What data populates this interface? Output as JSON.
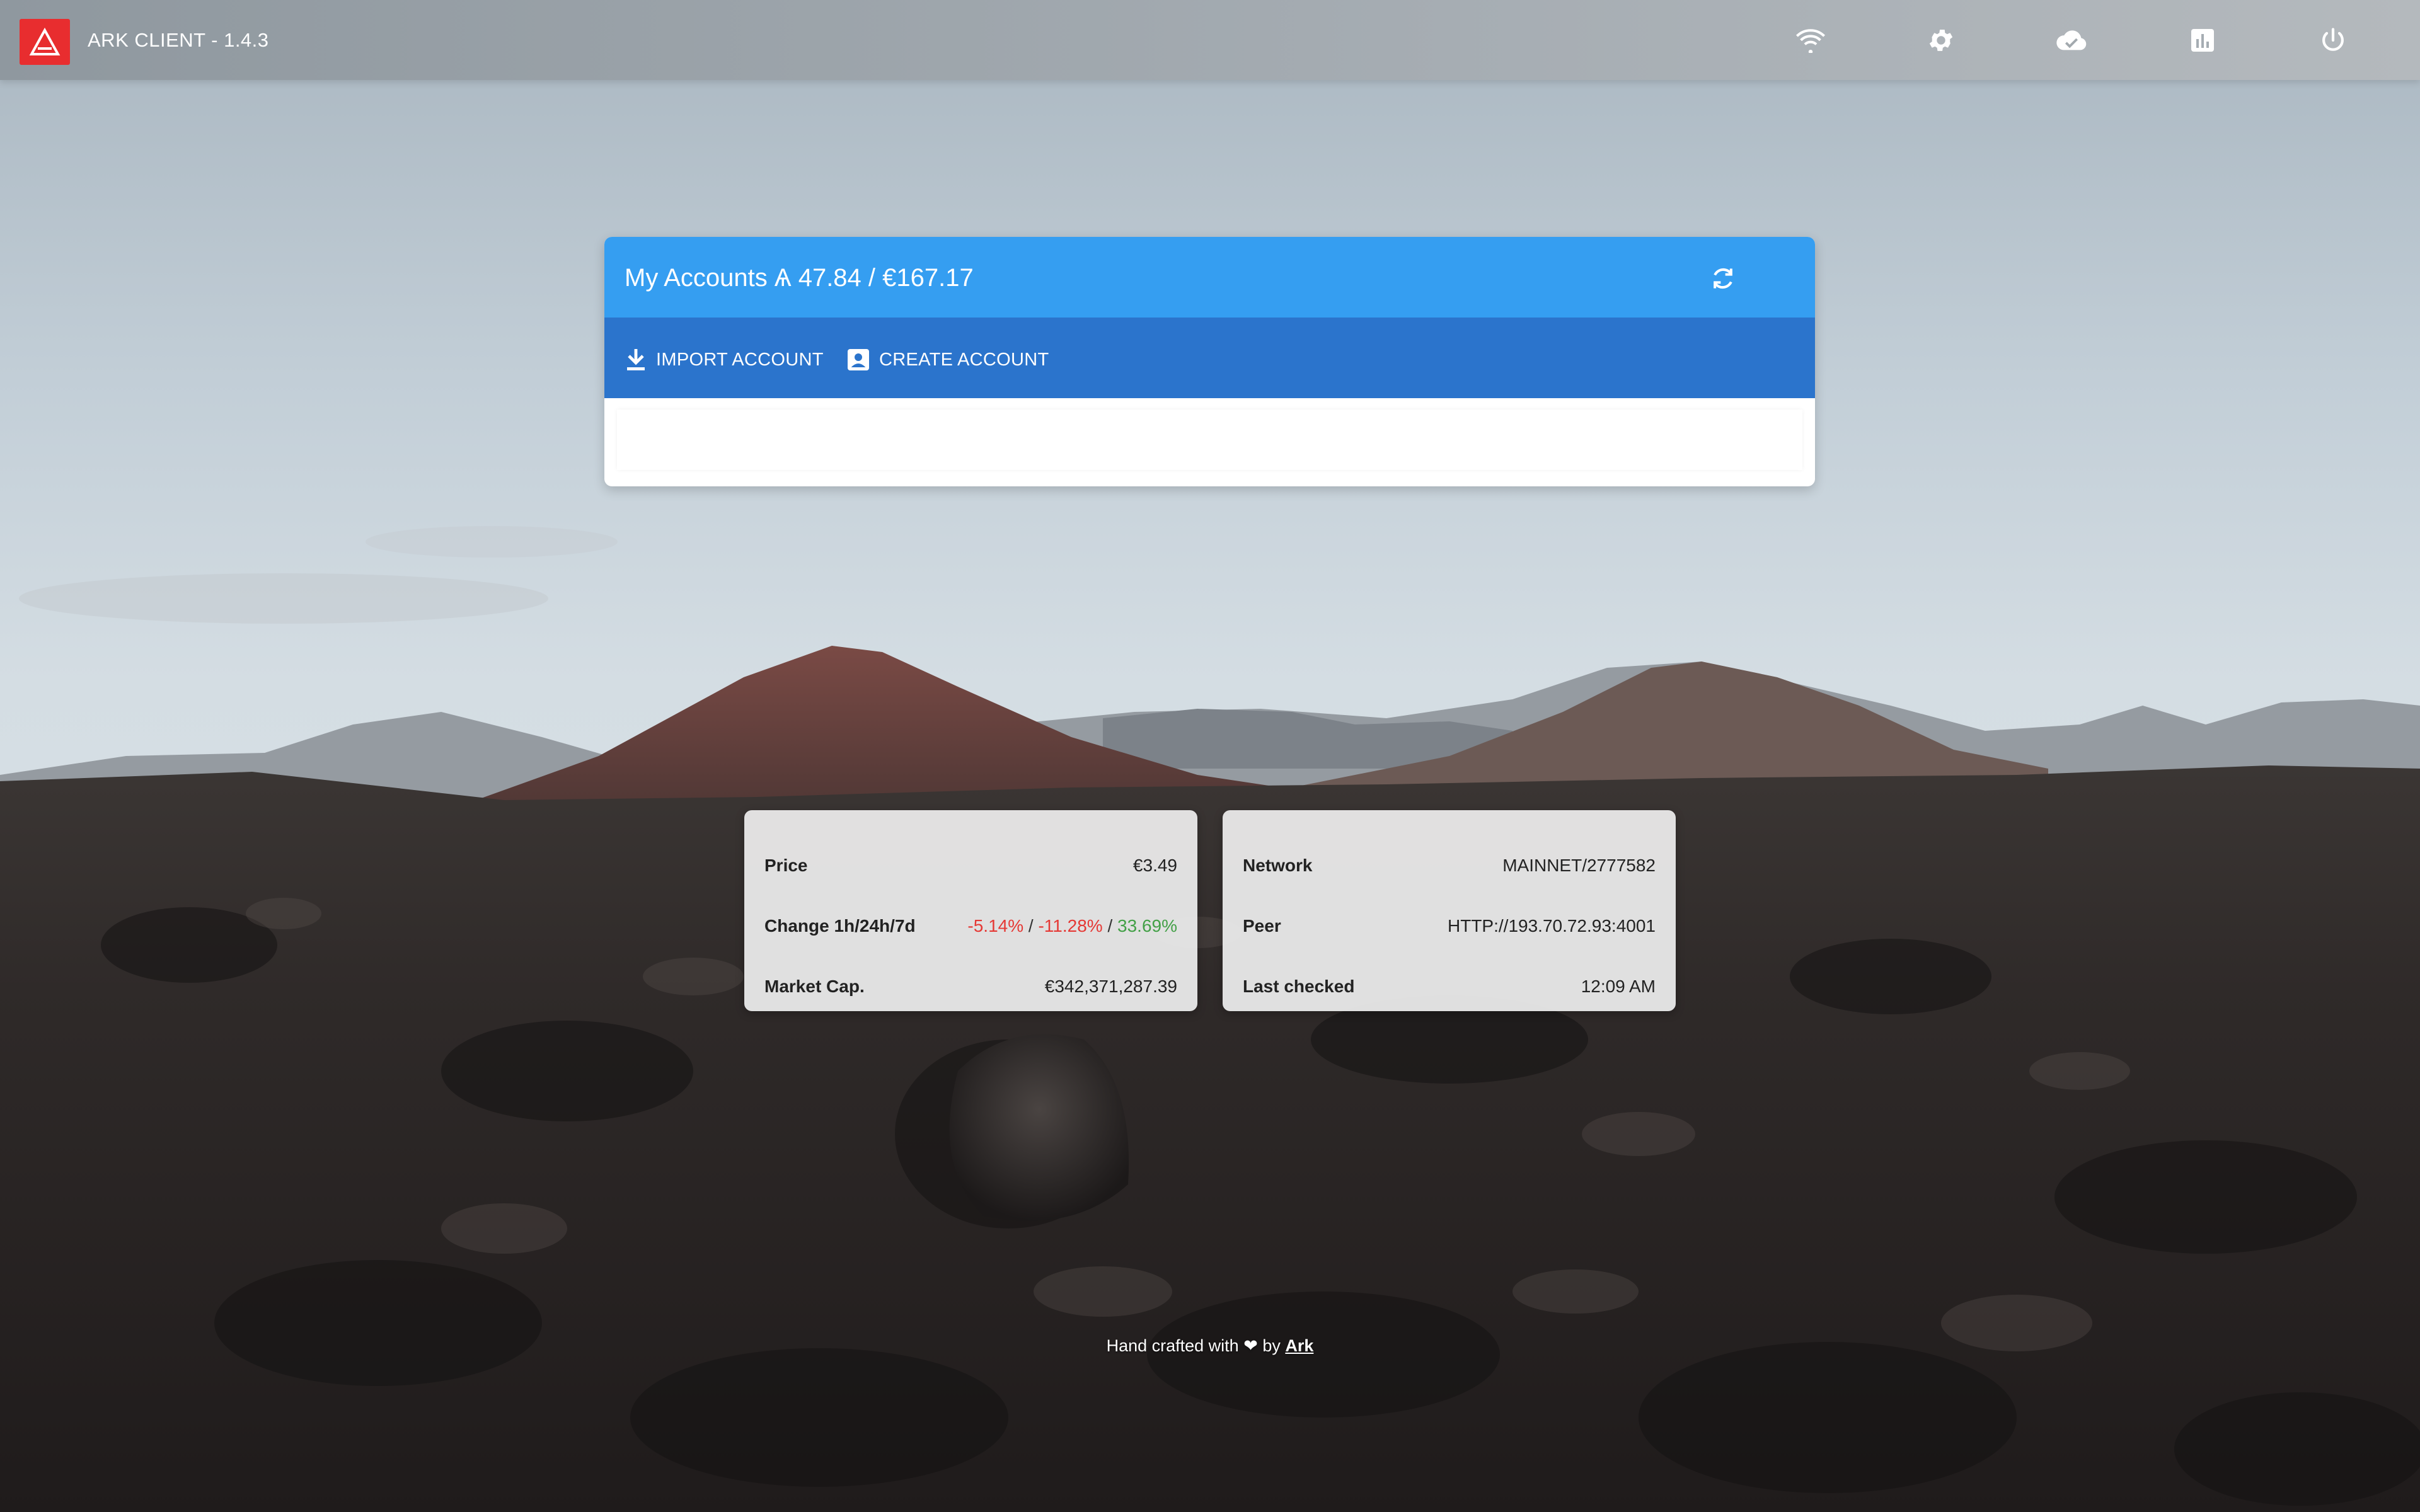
{
  "app": {
    "title": "ARK CLIENT - 1.4.3"
  },
  "toolbar_icons": [
    "wifi-icon",
    "gear-icon",
    "cloud-check-icon",
    "bar-chart-icon",
    "power-icon"
  ],
  "accounts": {
    "title": "My Accounts Ѧ 47.84 / €167.17",
    "import_label": "IMPORT ACCOUNT",
    "create_label": "CREATE ACCOUNT"
  },
  "market": {
    "price_label": "Price",
    "price_value": "€3.49",
    "change_label": "Change 1h/24h/7d",
    "change_1h": "-5.14%",
    "change_24h": "-11.28%",
    "change_7d": "33.69%",
    "change_sep": "/",
    "marketcap_label": "Market Cap.",
    "marketcap_value": "€342,371,287.39"
  },
  "network": {
    "network_label": "Network",
    "network_value": "MAINNET/2777582",
    "peer_label": "Peer",
    "peer_value": "HTTP://193.70.72.93:4001",
    "checked_label": "Last checked",
    "checked_value": "12:09 AM"
  },
  "footer": {
    "text": "Hand crafted with ❤ by",
    "link": "Ark"
  },
  "colors": {
    "accent": "#359ef1",
    "toolbar": "#2b74cc",
    "logo": "#e82d2f",
    "negative": "#e53935",
    "positive": "#43a047"
  }
}
